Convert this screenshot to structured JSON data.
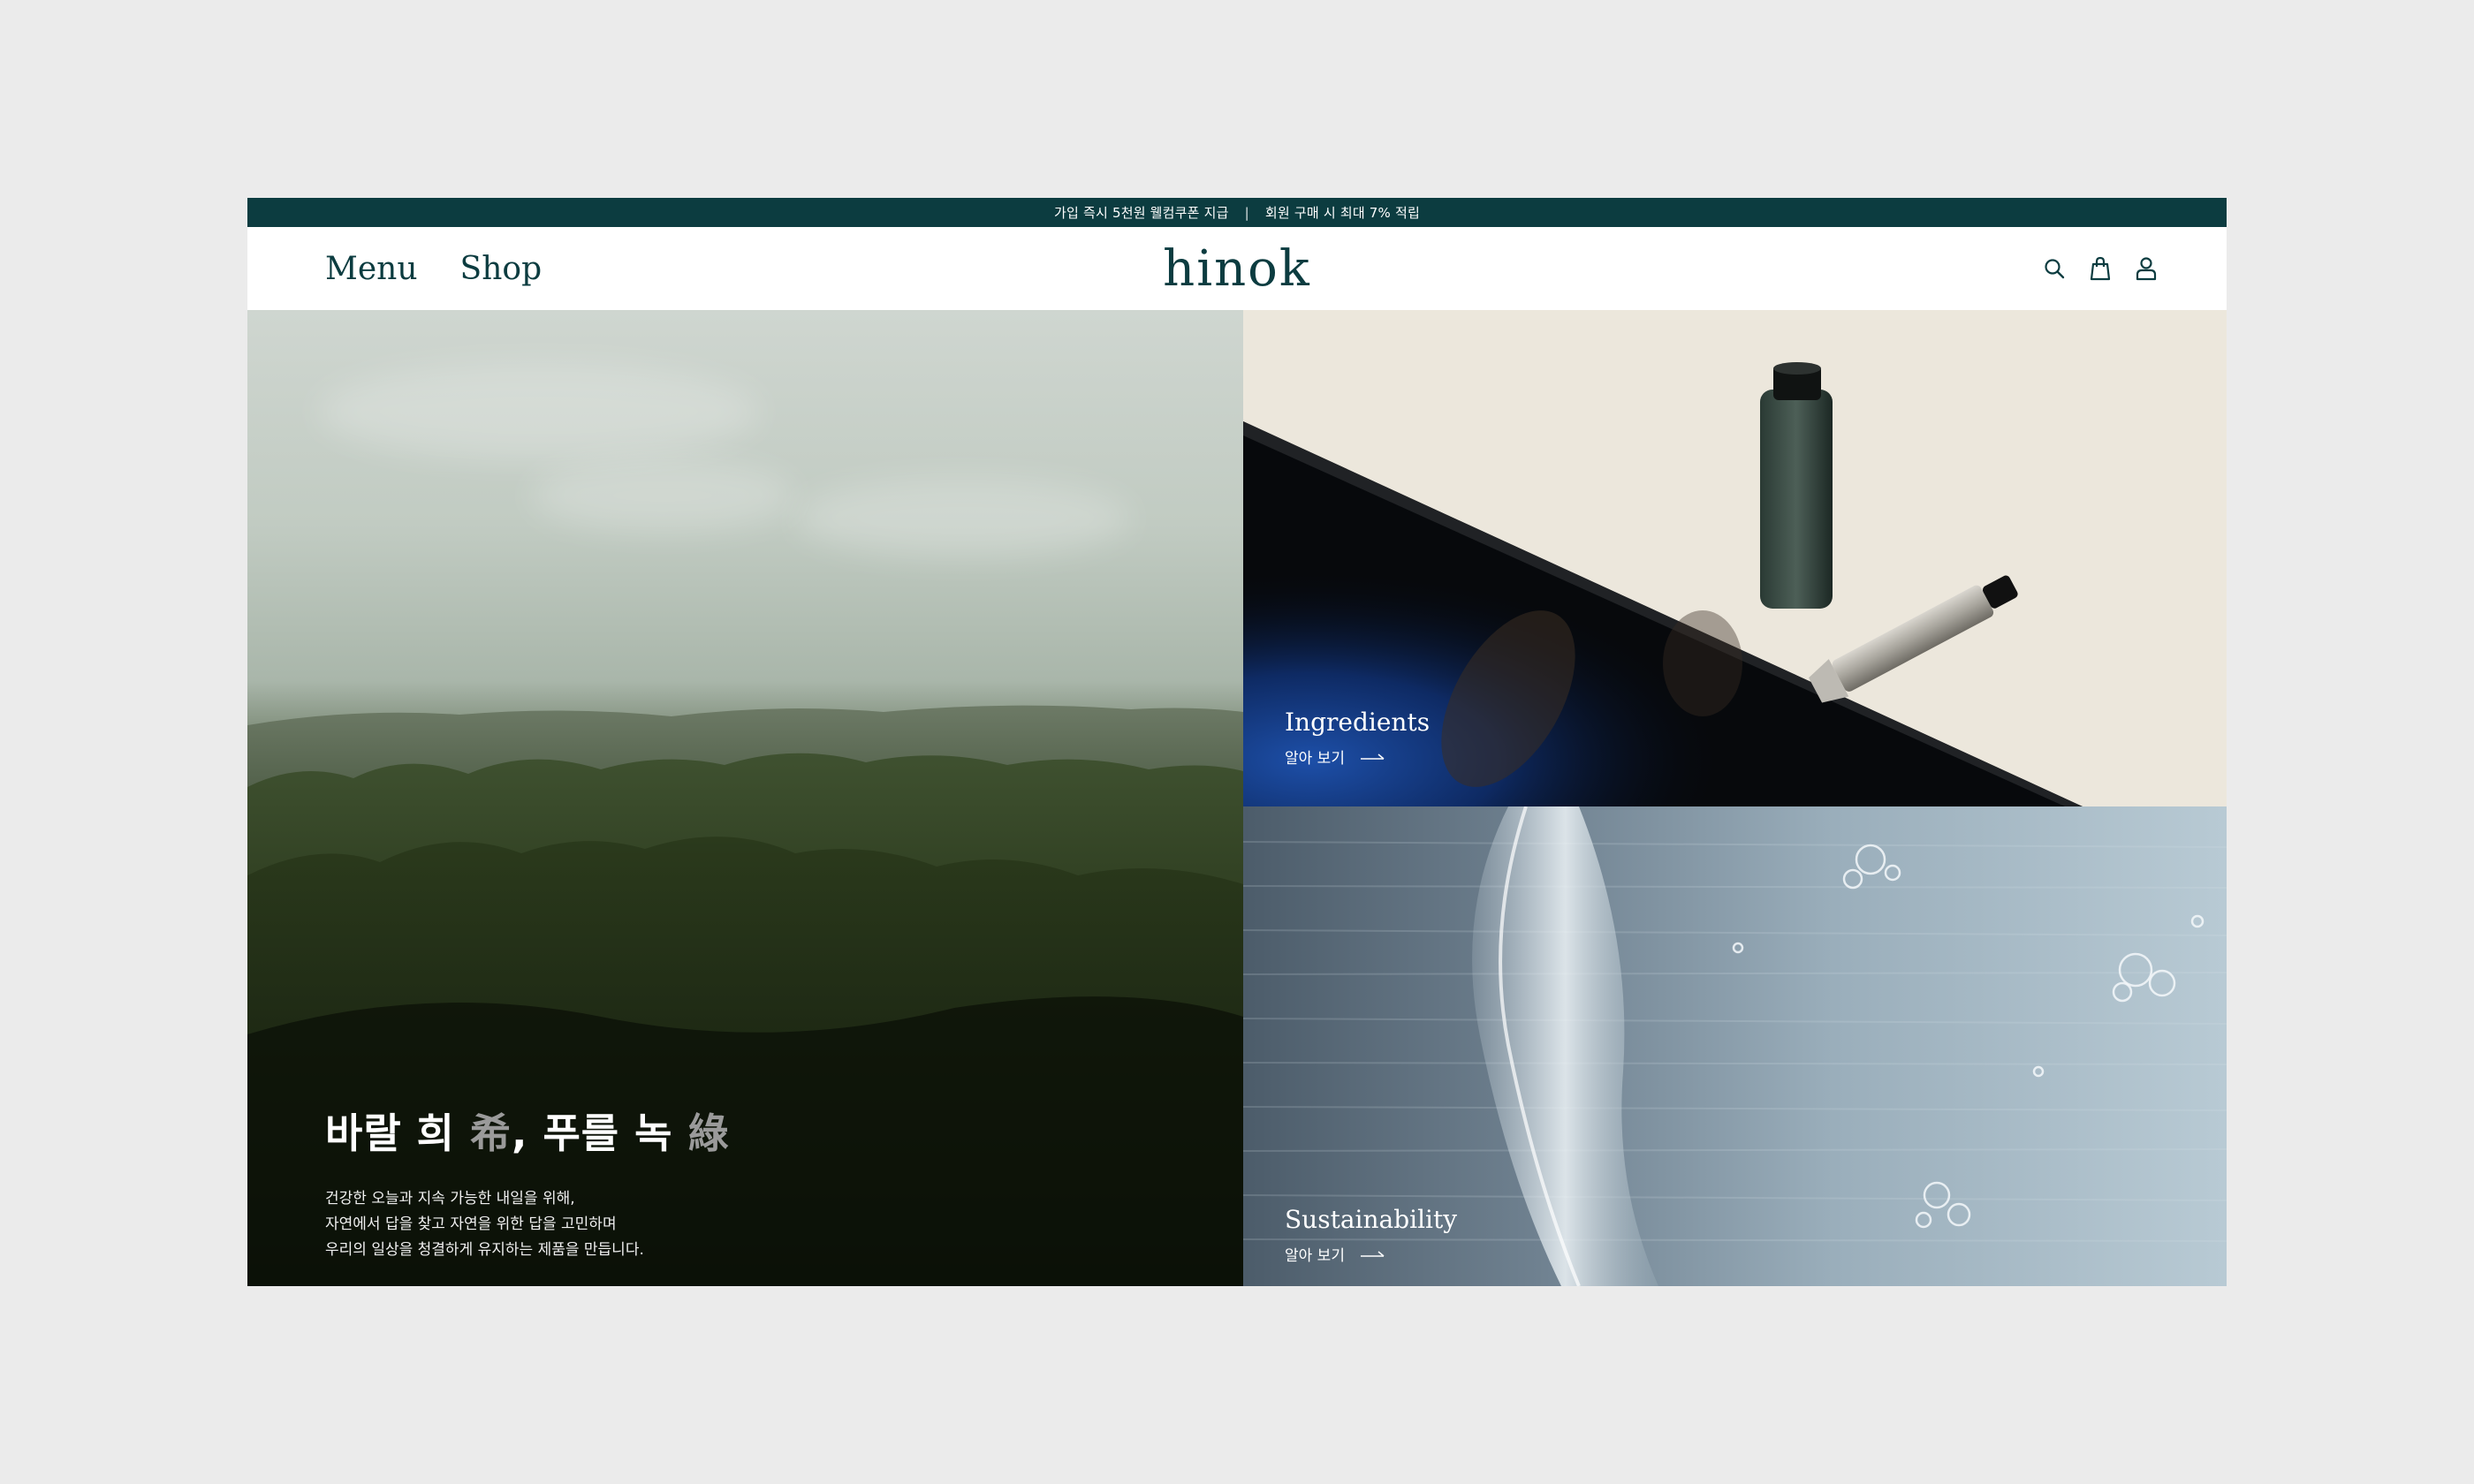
{
  "announcement": {
    "left": "가입 즉시 5천원 웰컴쿠폰 지급",
    "separator": "|",
    "right": "회원 구매 시 최대 7% 적립"
  },
  "nav": {
    "menu": "Menu",
    "shop": "Shop"
  },
  "brand": {
    "logo": "hinok",
    "color": "#0c3c40"
  },
  "header_icons": [
    "search-icon",
    "bag-icon",
    "user-icon"
  ],
  "hero": {
    "title_part1": "바랄 희 ",
    "title_hanja1": "希",
    "title_part2": ", 푸를 녹 ",
    "title_hanja2": "綠",
    "desc_line1": "건강한 오늘과 지속 가능한 내일을 위해,",
    "desc_line2": "자연에서 답을 찾고 자연을 위한 답을 고민하며",
    "desc_line3": "우리의 일상을 청결하게 유지하는 제품을 만듭니다."
  },
  "tiles": {
    "ingredients": {
      "title": "Ingredients",
      "link": "알아 보기"
    },
    "sustainability": {
      "title": "Sustainability",
      "link": "알아 보기"
    }
  }
}
